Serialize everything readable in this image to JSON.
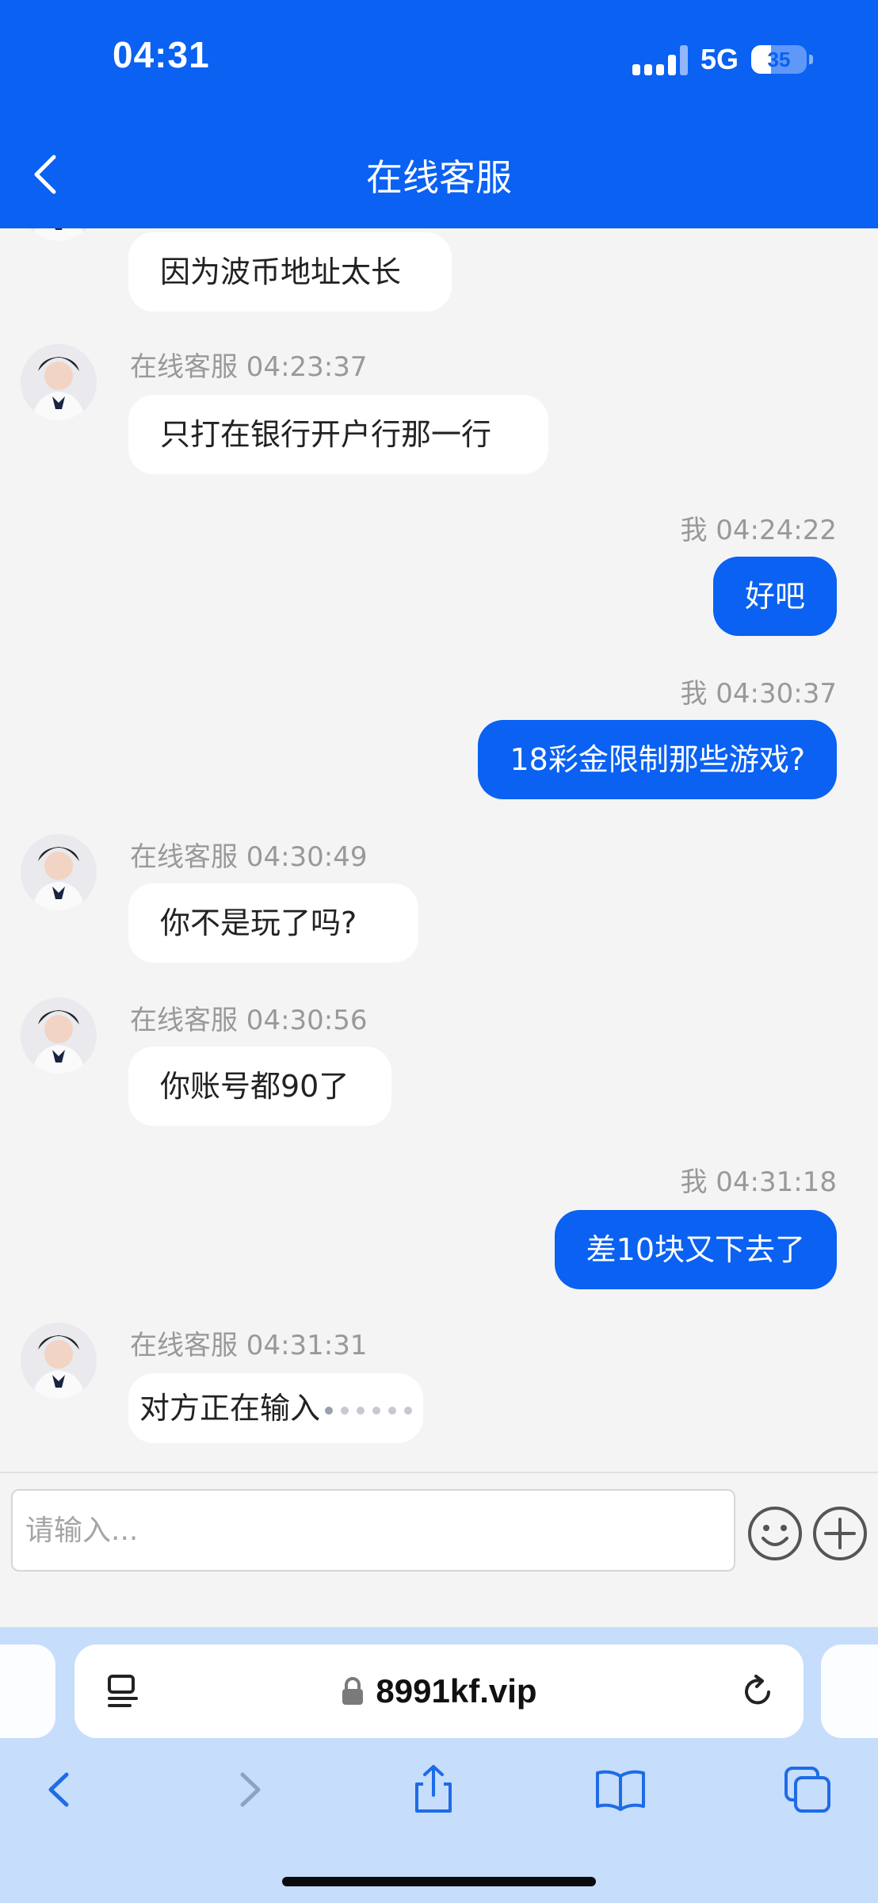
{
  "status_bar": {
    "time": "04:31",
    "network": "5G",
    "battery": "35",
    "battery_level": 0.35
  },
  "header": {
    "title": "在线客服"
  },
  "messages": [
    {
      "text": "因为波币地址太长"
    },
    {
      "meta": "在线客服 04:23:37",
      "text": "只打在银行开户行那一行"
    },
    {
      "meta": "我 04:24:22",
      "text": "好吧"
    },
    {
      "meta": "我 04:30:37",
      "text": "18彩金限制那些游戏?"
    },
    {
      "meta": "在线客服 04:30:49",
      "text": "你不是玩了吗?"
    },
    {
      "meta": "在线客服 04:30:56",
      "text": "你账号都90了"
    },
    {
      "meta": "我 04:31:18",
      "text": "差10块又下去了"
    },
    {
      "meta": "在线客服 04:31:31",
      "text": "对方正在输入"
    }
  ],
  "input": {
    "placeholder": "请输入..."
  },
  "browser": {
    "url": "8991kf.vip"
  },
  "colors": {
    "accent": "#0a61f2",
    "background": "#f4f4f4",
    "browser_bar": "#c6ddfb"
  },
  "icons": [
    "back-chevron-icon",
    "emoji-icon",
    "plus-icon",
    "reader-icon",
    "lock-icon",
    "reload-icon",
    "back-icon",
    "forward-icon",
    "share-icon",
    "bookmarks-icon",
    "tabs-icon"
  ]
}
